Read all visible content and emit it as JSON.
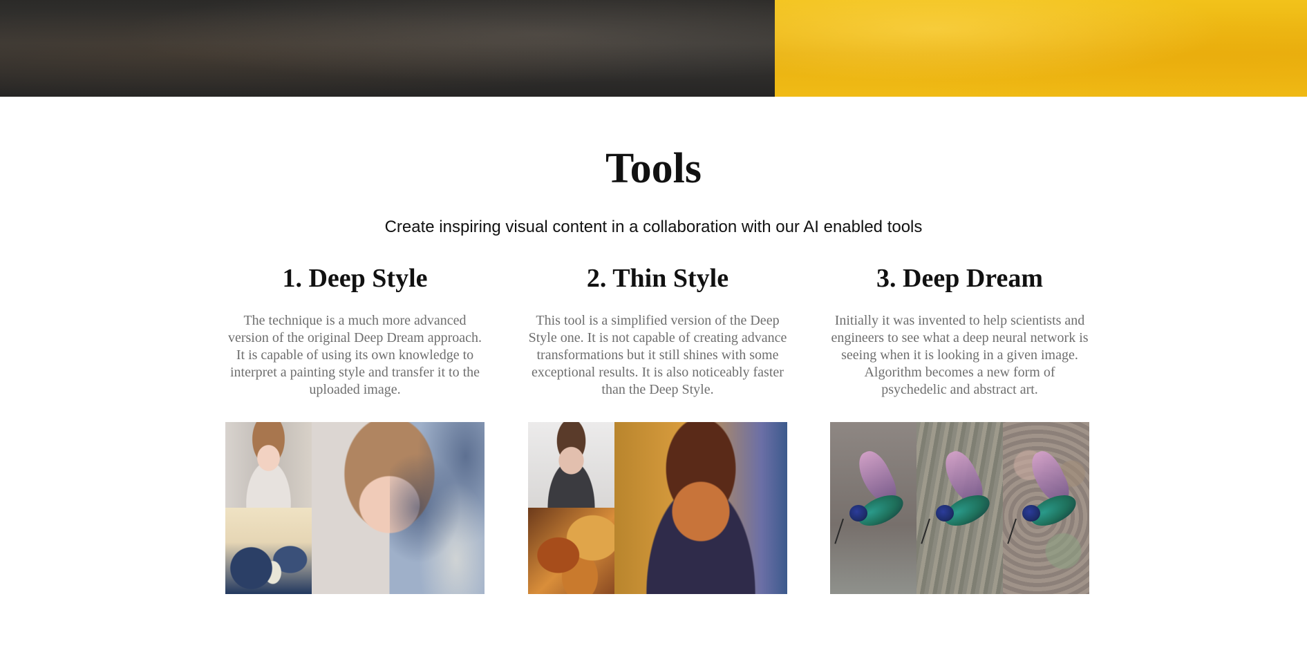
{
  "hero": {
    "left_color": "#2f2d2b",
    "right_color": "#f0bb16"
  },
  "tools": {
    "title": "Tools",
    "subtitle": "Create inspiring visual content in a collaboration with our AI enabled tools"
  },
  "cards": [
    {
      "title": "1. Deep Style",
      "description": "The technique is a much more advanced version of the original Deep Dream approach. It is capable of using its own knowledge to interpret a painting style and transfer it to the uploaded image.",
      "image": "deep-style-example-image"
    },
    {
      "title": "2. Thin Style",
      "description": "This tool is a simplified version of the Deep Style one. It is not capable of creating advance transformations but it still shines with some exceptional results. It is also noticeably faster than the Deep Style.",
      "image": "thin-style-example-image"
    },
    {
      "title": "3. Deep Dream",
      "description": "Initially it was invented to help scientists and engineers to see what a deep neural network is seeing when it is looking in a given image. Algorithm becomes a new form of psychedelic and abstract art.",
      "image": "deep-dream-example-image"
    }
  ]
}
